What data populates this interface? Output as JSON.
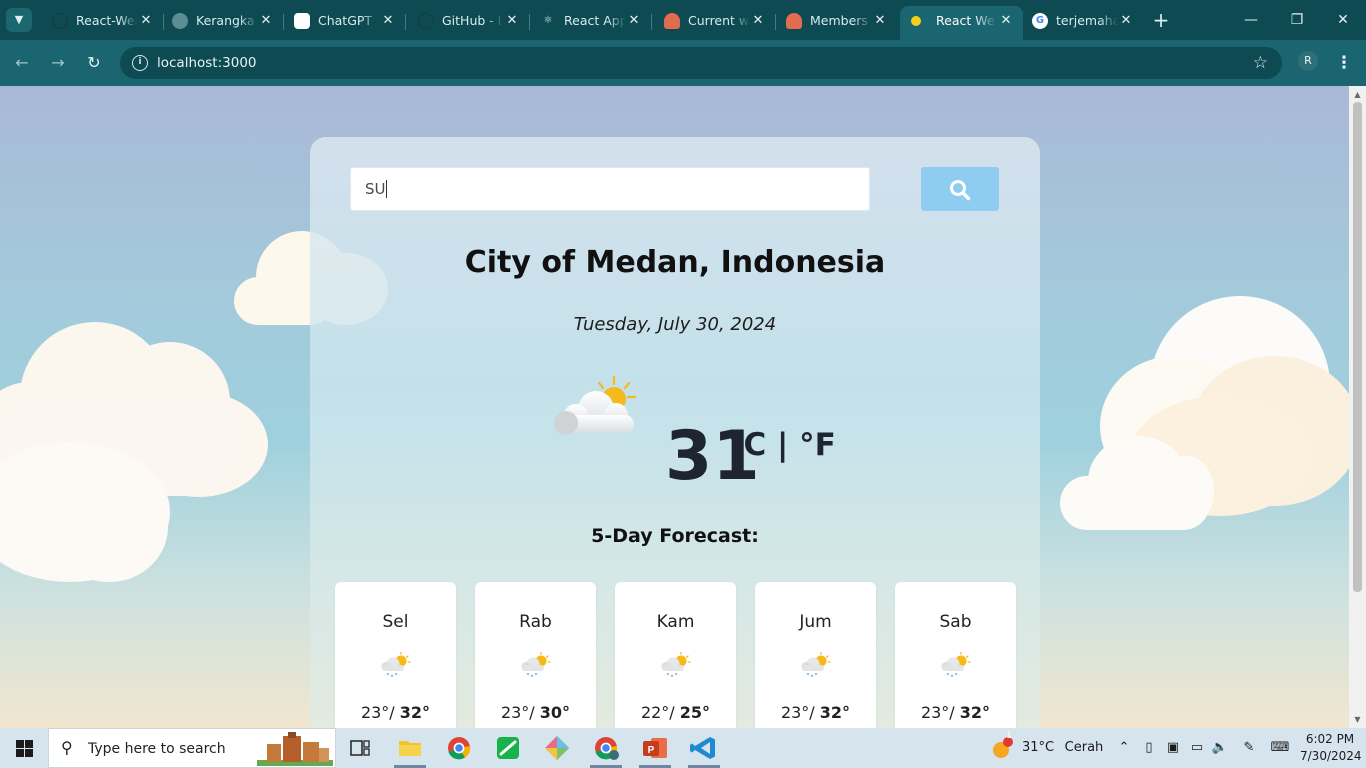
{
  "browser": {
    "tabs": [
      {
        "title": "React-Weather-App",
        "icon": "github-icon"
      },
      {
        "title": "Kerangka",
        "icon": "globe-icon"
      },
      {
        "title": "ChatGPT",
        "icon": "chatgpt-icon"
      },
      {
        "title": "GitHub - l",
        "icon": "github-icon"
      },
      {
        "title": "React App",
        "icon": "react-icon"
      },
      {
        "title": "Current w",
        "icon": "weather-icon"
      },
      {
        "title": "Members",
        "icon": "weather-icon"
      },
      {
        "title": "React We",
        "icon": "sun-icon",
        "active": true
      },
      {
        "title": "terjemaha",
        "icon": "google-icon"
      }
    ],
    "close_glyph": "✕",
    "new_tab_glyph": "+",
    "url": "localhost:3000",
    "profile_initial": "R"
  },
  "app": {
    "search": {
      "value": "SU",
      "placeholder": ""
    },
    "city": "City of Medan, Indonesia",
    "date": "Tuesday, July 30, 2024",
    "temperature": "31",
    "units": "°C | °F",
    "forecast_title": "5-Day Forecast:",
    "forecast": [
      {
        "day": "Sel",
        "min": "23°/",
        "max": "32°"
      },
      {
        "day": "Rab",
        "min": "23°/",
        "max": "30°"
      },
      {
        "day": "Kam",
        "min": "22°/",
        "max": "25°"
      },
      {
        "day": "Jum",
        "min": "23°/",
        "max": "32°"
      },
      {
        "day": "Sab",
        "min": "23°/",
        "max": "32°"
      }
    ]
  },
  "taskbar": {
    "search_placeholder": "Type here to search",
    "weather_temp": "31°C",
    "weather_desc": "Cerah",
    "weather_badge": "1",
    "time": "6:02 PM",
    "date": "7/30/2024"
  },
  "colors": {
    "titlebar": "#0d4a52",
    "toolbar": "#1a6570",
    "search_button": "#8fcdf0",
    "accent_sun": "#f6b91c"
  }
}
